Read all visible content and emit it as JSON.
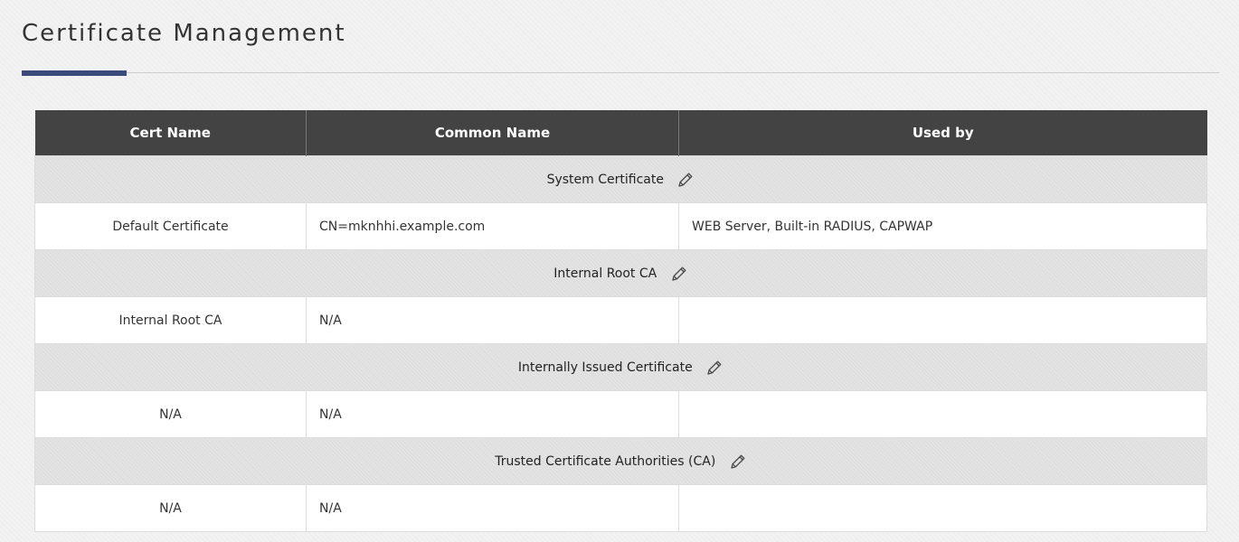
{
  "page": {
    "title": "Certificate Management"
  },
  "table": {
    "columns": [
      "Cert Name",
      "Common Name",
      "Used by"
    ],
    "sections": [
      {
        "title": "System Certificate",
        "edit_icon": "pencil-icon",
        "row": {
          "cert_name": "Default Certificate",
          "common_name": "CN=mknhhi.example.com",
          "used_by": "WEB Server, Built-in RADIUS, CAPWAP"
        }
      },
      {
        "title": "Internal Root CA",
        "edit_icon": "pencil-icon",
        "row": {
          "cert_name": "Internal Root CA",
          "common_name": "N/A",
          "used_by": ""
        }
      },
      {
        "title": "Internally Issued Certificate",
        "edit_icon": "pencil-icon",
        "row": {
          "cert_name": "N/A",
          "common_name": "N/A",
          "used_by": ""
        }
      },
      {
        "title": "Trusted Certificate Authorities (CA)",
        "edit_icon": "pencil-icon",
        "row": {
          "cert_name": "N/A",
          "common_name": "N/A",
          "used_by": ""
        }
      }
    ]
  },
  "colors": {
    "header_bg": "#434343",
    "accent": "#3a4a7a",
    "section_bg": "#e3e3e3"
  }
}
